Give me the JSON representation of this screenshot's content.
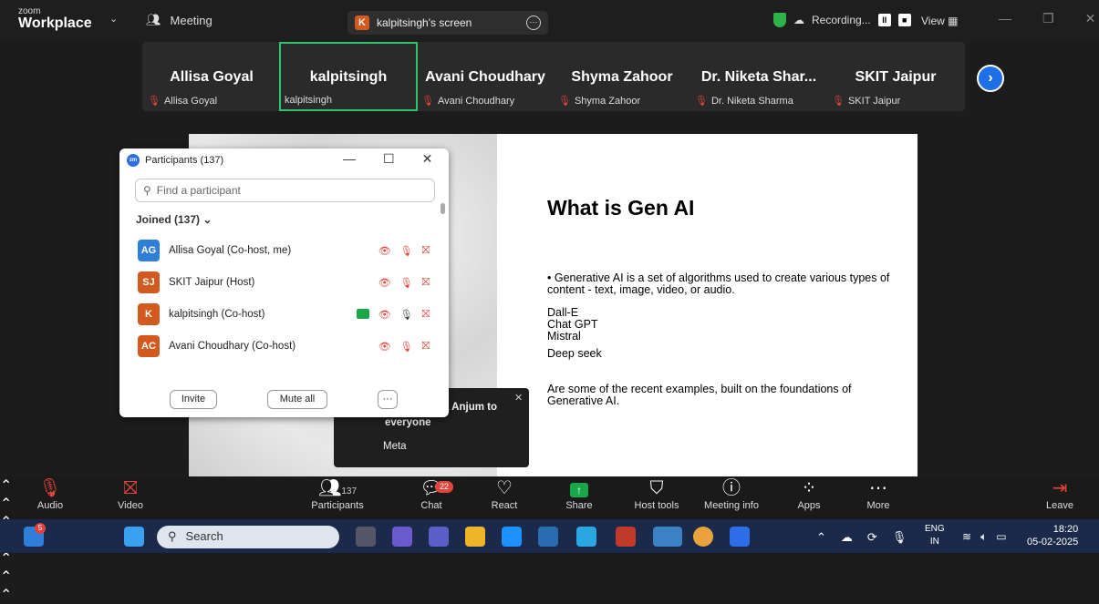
{
  "app": {
    "brand_line1": "zoom",
    "brand_line2": "Workplace",
    "meeting_label": "Meeting",
    "screen_share": "kalpitsingh's screen",
    "screen_share_initial": "K",
    "recording": "Recording...",
    "view": "View"
  },
  "gallery": [
    {
      "name": "Allisa Goyal",
      "sub": "Allisa Goyal",
      "muted": true
    },
    {
      "name": "kalpitsingh",
      "sub": "kalpitsingh",
      "muted": false
    },
    {
      "name": "Avani Choudhary",
      "sub": "Avani Choudhary",
      "muted": true
    },
    {
      "name": "Shyma Zahoor",
      "sub": "Shyma Zahoor",
      "muted": true
    },
    {
      "name": "Dr. Niketa Shar...",
      "sub": "Dr. Niketa Sharma",
      "muted": true
    },
    {
      "name": "SKIT Jaipur",
      "sub": "SKIT Jaipur",
      "muted": true
    }
  ],
  "slide": {
    "title": "What is Gen AI",
    "bullet": "•   Generative AI is a set of algorithms used to create various types of content - text, image, video, or audio.",
    "items": [
      "Dall-E",
      "Chat GPT",
      "Mistral"
    ],
    "item4": "Deep seek",
    "closing": "Are some of the recent examples, built on the foundations of Generative AI.",
    "cursor": "I"
  },
  "participants": {
    "title": "Participants (137)",
    "logo": "zm",
    "search_placeholder": "Find a participant",
    "joined": "Joined (137)",
    "invite": "Invite",
    "mute_all": "Mute all",
    "more": "···",
    "rows": [
      {
        "initials": "AG",
        "name": "Allisa Goyal (Co-host, me)",
        "color": "#2f7ed8"
      },
      {
        "initials": "SJ",
        "name": "SKIT Jaipur (Host)",
        "color": "#d35a1e"
      },
      {
        "initials": "K",
        "name": "kalpitsingh (Co-host)",
        "color": "#d35a1e"
      },
      {
        "initials": "AC",
        "name": "Avani Choudhary (Co-host)",
        "color": "#d35a1e"
      }
    ]
  },
  "chat_popup": {
    "line1": "a Anjum to",
    "line2": "everyone",
    "line3": "Meta"
  },
  "toolbar": {
    "audio": "Audio",
    "video": "Video",
    "participants": "Participants",
    "participants_count": "137",
    "chat": "Chat",
    "chat_badge": "22",
    "react": "React",
    "share": "Share",
    "host_tools": "Host tools",
    "meeting_info": "Meeting info",
    "apps": "Apps",
    "more": "More",
    "leave": "Leave"
  },
  "taskbar": {
    "search": "Search",
    "lang1": "ENG",
    "lang2": "IN",
    "time": "18:20",
    "date": "05-02-2025",
    "notif": "5"
  }
}
